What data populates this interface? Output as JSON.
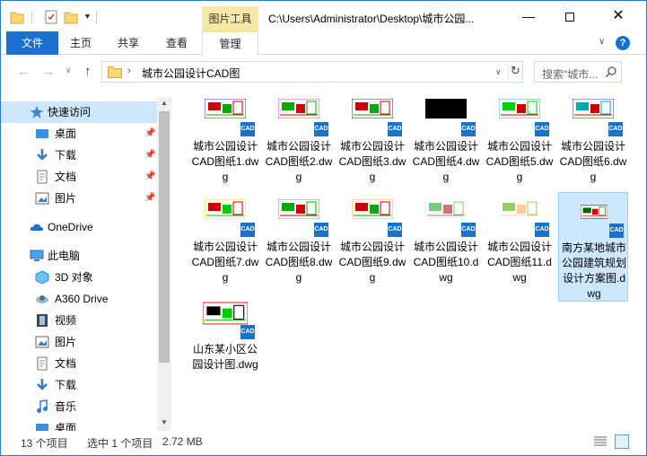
{
  "titlebar": {
    "context_tab": "图片工具",
    "path_title": "C:\\Users\\Administrator\\Desktop\\城市公园..."
  },
  "ribbon": {
    "tabs": [
      {
        "label": "文件"
      },
      {
        "label": "主页"
      },
      {
        "label": "共享"
      },
      {
        "label": "查看"
      },
      {
        "label": "管理"
      }
    ],
    "help": "?"
  },
  "address": {
    "current": "城市公园设计CAD图",
    "search_placeholder": "搜索\"城市..."
  },
  "sidebar": {
    "items": [
      {
        "label": "快速访问",
        "icon": "star-icon",
        "selected": true
      },
      {
        "label": "桌面",
        "icon": "desktop-icon",
        "pinned": true
      },
      {
        "label": "下载",
        "icon": "download-icon",
        "pinned": true
      },
      {
        "label": "文档",
        "icon": "document-icon",
        "pinned": true
      },
      {
        "label": "图片",
        "icon": "picture-icon",
        "pinned": true
      },
      {
        "label": "OneDrive",
        "icon": "cloud-icon"
      },
      {
        "label": "此电脑",
        "icon": "computer-icon"
      },
      {
        "label": "3D 对象",
        "icon": "cube-icon"
      },
      {
        "label": "A360 Drive",
        "icon": "a360-icon"
      },
      {
        "label": "视频",
        "icon": "video-icon"
      },
      {
        "label": "图片",
        "icon": "picture-icon"
      },
      {
        "label": "文档",
        "icon": "document-icon"
      },
      {
        "label": "下载",
        "icon": "download-icon"
      },
      {
        "label": "音乐",
        "icon": "music-icon"
      },
      {
        "label": "桌面",
        "icon": "desktop-icon"
      }
    ]
  },
  "files": [
    {
      "name": "城市公园设计CAD图纸1.dwg",
      "badge": "CAD"
    },
    {
      "name": "城市公园设计CAD图纸2.dwg",
      "badge": "CAD"
    },
    {
      "name": "城市公园设计CAD图纸3.dwg",
      "badge": "CAD"
    },
    {
      "name": "城市公园设计CAD图纸4.dwg",
      "badge": "CAD"
    },
    {
      "name": "城市公园设计CAD图纸5.dwg",
      "badge": "CAD"
    },
    {
      "name": "城市公园设计CAD图纸6.dwg",
      "badge": "CAD"
    },
    {
      "name": "城市公园设计CAD图纸7.dwg",
      "badge": "CAD"
    },
    {
      "name": "城市公园设计CAD图纸8.dwg",
      "badge": "CAD"
    },
    {
      "name": "城市公园设计CAD图纸9.dwg",
      "badge": "CAD"
    },
    {
      "name": "城市公园设计CAD图纸10.dwg",
      "badge": "CAD"
    },
    {
      "name": "城市公园设计CAD图纸11.dwg",
      "badge": "CAD"
    },
    {
      "name": "南方某地城市公园建筑规划设计方案图.dwg",
      "badge": "CAD",
      "selected": true
    },
    {
      "name": "山东某小区公园设计图.dwg",
      "badge": "CAD"
    }
  ],
  "status": {
    "count": "13 个项目",
    "selected": "选中 1 个项目",
    "size": "2.72 MB"
  }
}
